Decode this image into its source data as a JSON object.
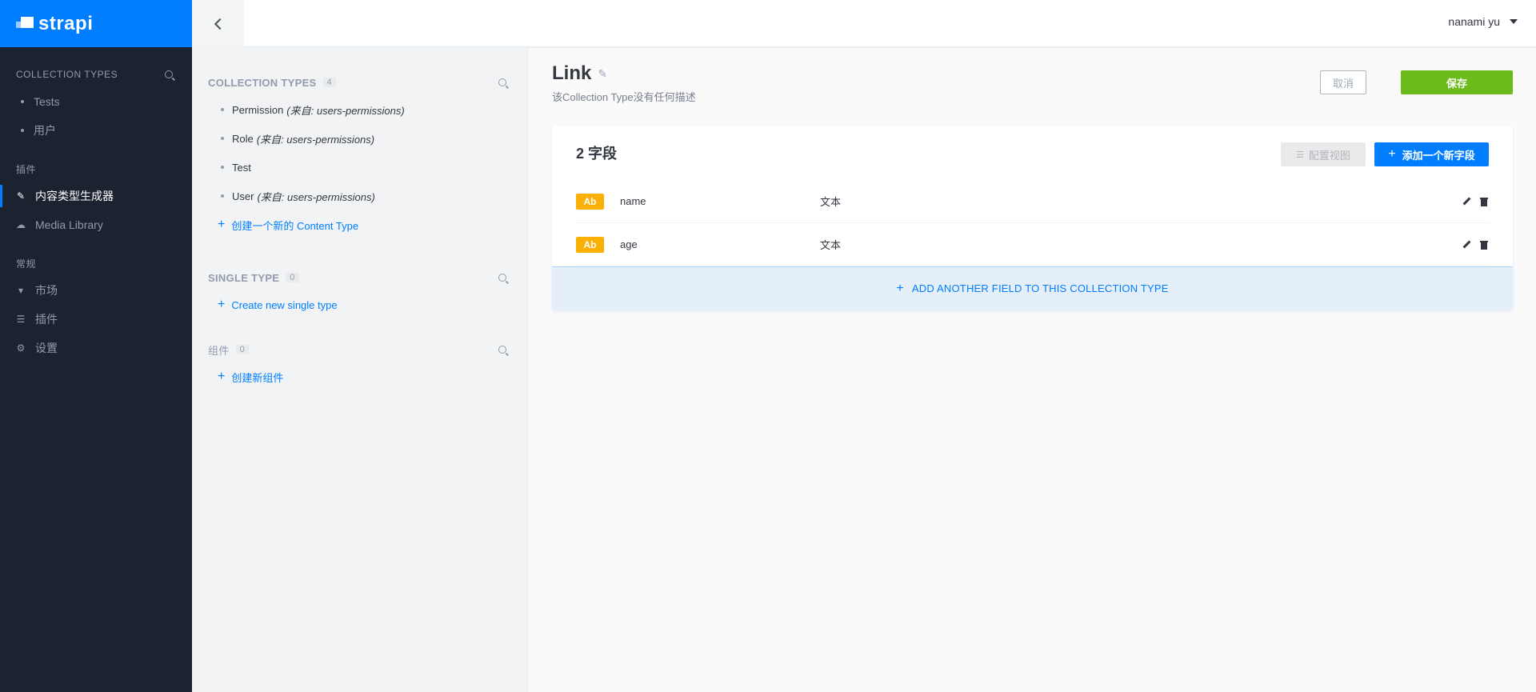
{
  "brand": {
    "name": "strapi"
  },
  "leftnav": {
    "collection_types_title": "COLLECTION TYPES",
    "collection_types": [
      {
        "label": "Tests"
      },
      {
        "label": "用户"
      }
    ],
    "plugins_title": "插件",
    "plugins": [
      {
        "label": "内容类型生成器",
        "icon": "paintbrush-icon",
        "active": true
      },
      {
        "label": "Media Library",
        "icon": "cloud-icon"
      }
    ],
    "general_title": "常规",
    "general": [
      {
        "label": "市场",
        "icon": "basket-icon"
      },
      {
        "label": "插件",
        "icon": "list-icon"
      },
      {
        "label": "设置",
        "icon": "gear-icon"
      }
    ]
  },
  "header": {
    "user_name": "nanami yu"
  },
  "ctb_menu": {
    "collection_types": {
      "title": "COLLECTION TYPES",
      "count": "4",
      "items": [
        {
          "name": "Permission",
          "source": "(来自: users-permissions)"
        },
        {
          "name": "Role",
          "source": "(来自: users-permissions)"
        },
        {
          "name": "Test",
          "source": ""
        },
        {
          "name": "User",
          "source": "(来自: users-permissions)"
        }
      ],
      "add_label": "创建一个新的 Content Type"
    },
    "single_type": {
      "title": "SINGLE TYPE",
      "count": "0",
      "add_label": "Create new single type"
    },
    "components": {
      "title": "组件",
      "count": "0",
      "add_label": "创建新组件"
    }
  },
  "main": {
    "title": "Link",
    "description": "该Collection Type没有任何描述",
    "cancel_label": "取消",
    "save_label": "保存",
    "fields_count_label": "2 字段",
    "configure_view_label": "配置视图",
    "add_field_label": "添加一个新字段",
    "fields": [
      {
        "badge": "Ab",
        "name": "name",
        "type": "文本"
      },
      {
        "badge": "Ab",
        "name": "age",
        "type": "文本"
      }
    ],
    "add_another_label": "ADD ANOTHER FIELD TO THIS COLLECTION TYPE"
  },
  "colors": {
    "brand_blue": "#007eff",
    "save_green": "#6dbb1a",
    "badge_yellow": "#fab005",
    "nav_bg": "#1b2230"
  }
}
